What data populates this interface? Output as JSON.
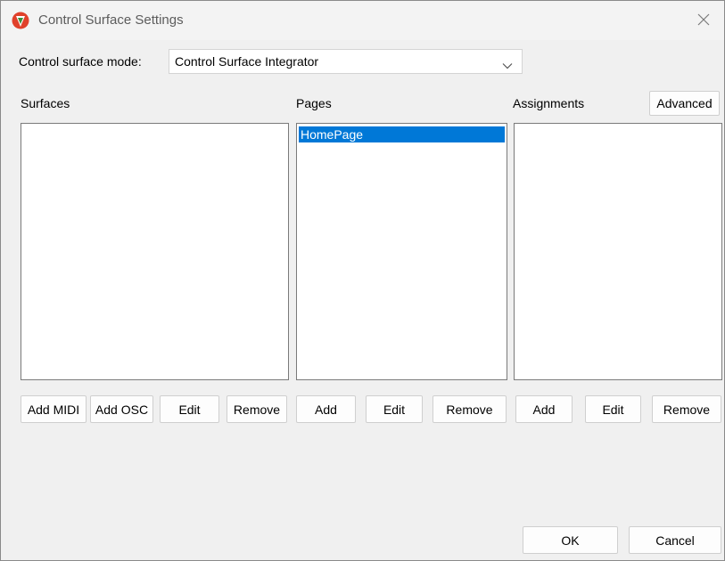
{
  "window": {
    "title": "Control Surface Settings",
    "icon": "reaper-logo-icon",
    "close_icon": "close-icon"
  },
  "mode": {
    "label": "Control surface mode:",
    "selected": "Control Surface Integrator"
  },
  "surfaces": {
    "label": "Surfaces",
    "items": [],
    "buttons": {
      "add_midi": "Add MIDI",
      "add_osc": "Add OSC",
      "edit": "Edit",
      "remove": "Remove"
    }
  },
  "pages": {
    "label": "Pages",
    "items": [
      {
        "label": "HomePage",
        "selected": true
      }
    ],
    "buttons": {
      "add": "Add",
      "edit": "Edit",
      "remove": "Remove"
    }
  },
  "assignments": {
    "label": "Assignments",
    "advanced": "Advanced",
    "items": [],
    "buttons": {
      "add": "Add",
      "edit": "Edit",
      "remove": "Remove"
    }
  },
  "footer": {
    "ok": "OK",
    "cancel": "Cancel"
  },
  "colors": {
    "selection": "#0078d7",
    "logo_red": "#e0412b",
    "logo_green": "#3a8f3a"
  }
}
